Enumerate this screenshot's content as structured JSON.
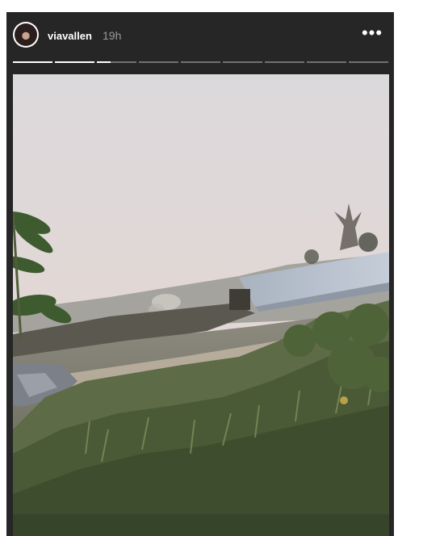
{
  "story": {
    "username": "viavallen",
    "time": "19h",
    "more_label": "•••",
    "segments": [
      1,
      1,
      0.35,
      0,
      0,
      0,
      0,
      0,
      0
    ],
    "icons": {
      "avatar": "profile-avatar",
      "more": "more-options-icon"
    },
    "colors": {
      "background": "#262626",
      "text": "#ffffff",
      "time": "#9a9a9a"
    }
  }
}
